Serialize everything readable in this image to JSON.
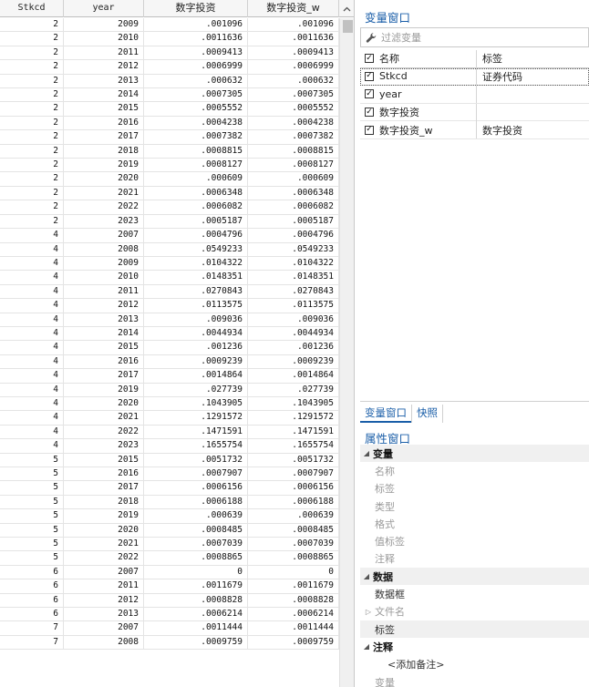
{
  "grid": {
    "columns": [
      "Stkcd",
      "year",
      "数字投资",
      "数字投资_w"
    ],
    "sort_icon": "chevron-up-icon",
    "rows": [
      [
        "2",
        "2009",
        ".001096",
        ".001096"
      ],
      [
        "2",
        "2010",
        ".0011636",
        ".0011636"
      ],
      [
        "2",
        "2011",
        ".0009413",
        ".0009413"
      ],
      [
        "2",
        "2012",
        ".0006999",
        ".0006999"
      ],
      [
        "2",
        "2013",
        ".000632",
        ".000632"
      ],
      [
        "2",
        "2014",
        ".0007305",
        ".0007305"
      ],
      [
        "2",
        "2015",
        ".0005552",
        ".0005552"
      ],
      [
        "2",
        "2016",
        ".0004238",
        ".0004238"
      ],
      [
        "2",
        "2017",
        ".0007382",
        ".0007382"
      ],
      [
        "2",
        "2018",
        ".0008815",
        ".0008815"
      ],
      [
        "2",
        "2019",
        ".0008127",
        ".0008127"
      ],
      [
        "2",
        "2020",
        ".000609",
        ".000609"
      ],
      [
        "2",
        "2021",
        ".0006348",
        ".0006348"
      ],
      [
        "2",
        "2022",
        ".0006082",
        ".0006082"
      ],
      [
        "2",
        "2023",
        ".0005187",
        ".0005187"
      ],
      [
        "4",
        "2007",
        ".0004796",
        ".0004796"
      ],
      [
        "4",
        "2008",
        ".0549233",
        ".0549233"
      ],
      [
        "4",
        "2009",
        ".0104322",
        ".0104322"
      ],
      [
        "4",
        "2010",
        ".0148351",
        ".0148351"
      ],
      [
        "4",
        "2011",
        ".0270843",
        ".0270843"
      ],
      [
        "4",
        "2012",
        ".0113575",
        ".0113575"
      ],
      [
        "4",
        "2013",
        ".009036",
        ".009036"
      ],
      [
        "4",
        "2014",
        ".0044934",
        ".0044934"
      ],
      [
        "4",
        "2015",
        ".001236",
        ".001236"
      ],
      [
        "4",
        "2016",
        ".0009239",
        ".0009239"
      ],
      [
        "4",
        "2017",
        ".0014864",
        ".0014864"
      ],
      [
        "4",
        "2019",
        ".027739",
        ".027739"
      ],
      [
        "4",
        "2020",
        ".1043905",
        ".1043905"
      ],
      [
        "4",
        "2021",
        ".1291572",
        ".1291572"
      ],
      [
        "4",
        "2022",
        ".1471591",
        ".1471591"
      ],
      [
        "4",
        "2023",
        ".1655754",
        ".1655754"
      ],
      [
        "5",
        "2015",
        ".0051732",
        ".0051732"
      ],
      [
        "5",
        "2016",
        ".0007907",
        ".0007907"
      ],
      [
        "5",
        "2017",
        ".0006156",
        ".0006156"
      ],
      [
        "5",
        "2018",
        ".0006188",
        ".0006188"
      ],
      [
        "5",
        "2019",
        ".000639",
        ".000639"
      ],
      [
        "5",
        "2020",
        ".0008485",
        ".0008485"
      ],
      [
        "5",
        "2021",
        ".0007039",
        ".0007039"
      ],
      [
        "5",
        "2022",
        ".0008865",
        ".0008865"
      ],
      [
        "6",
        "2007",
        "0",
        "0"
      ],
      [
        "6",
        "2011",
        ".0011679",
        ".0011679"
      ],
      [
        "6",
        "2012",
        ".0008828",
        ".0008828"
      ],
      [
        "6",
        "2013",
        ".0006214",
        ".0006214"
      ],
      [
        "7",
        "2007",
        ".0011444",
        ".0011444"
      ],
      [
        "7",
        "2008",
        ".0009759",
        ".0009759"
      ]
    ]
  },
  "variables_pane": {
    "title": "变量窗口",
    "filter_placeholder": "过滤变量",
    "filter_icon": "wrench-icon",
    "header": {
      "name": "名称",
      "label": "标签"
    },
    "items": [
      {
        "name": "Stkcd",
        "label": "证券代码",
        "checked": true
      },
      {
        "name": "year",
        "label": "",
        "checked": true
      },
      {
        "name": "数字投资",
        "label": "",
        "checked": true
      },
      {
        "name": "数字投资_w",
        "label": "数字投资",
        "checked": true
      }
    ]
  },
  "tabs": [
    {
      "label": "变量窗口",
      "active": true
    },
    {
      "label": "快照",
      "active": false
    }
  ],
  "properties_pane": {
    "title": "属性窗口",
    "variable_group": "变量",
    "variable_fields": [
      "名称",
      "标签",
      "类型",
      "格式",
      "值标签",
      "注释"
    ],
    "data_group": "数据",
    "data_fields": [
      "数据框",
      "文件名",
      "标签"
    ],
    "notes_group": "注释",
    "add_note": "<添加备注>",
    "bottom_item": "变量"
  }
}
